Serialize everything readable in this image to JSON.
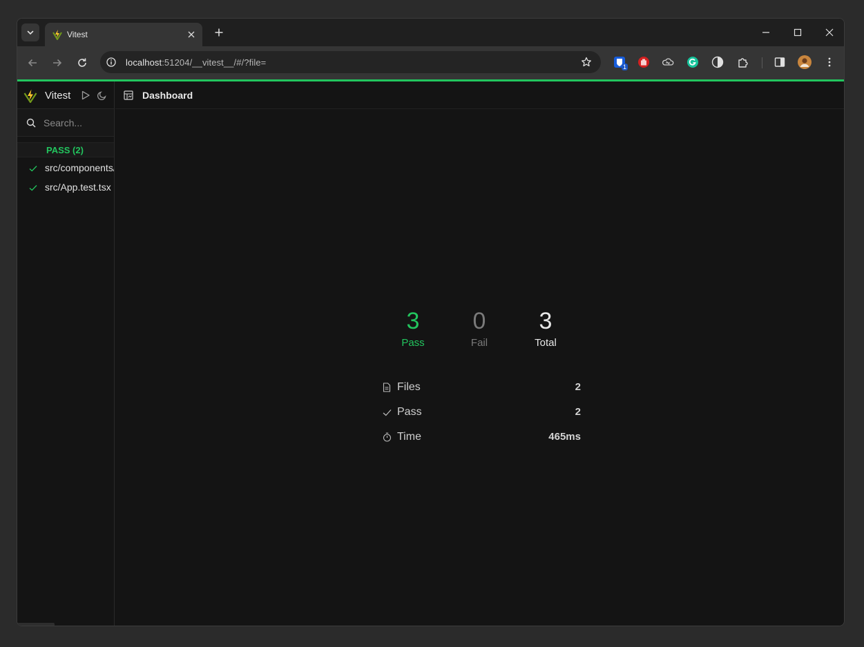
{
  "browser": {
    "tab_title": "Vitest",
    "url_host": "localhost",
    "url_rest": ":51204/__vitest__/#/?file=",
    "extension_badge": "1"
  },
  "app": {
    "brand": "Vitest",
    "search_placeholder": "Search...",
    "group_label": "PASS (2)",
    "files": [
      {
        "name": "src/components/Counter.test.tsx"
      },
      {
        "name": "src/App.test.tsx"
      }
    ]
  },
  "main": {
    "header_title": "Dashboard",
    "stats": [
      {
        "value": "3",
        "label": "Pass"
      },
      {
        "value": "0",
        "label": "Fail"
      },
      {
        "value": "3",
        "label": "Total"
      }
    ],
    "summary": [
      {
        "label": "Files",
        "value": "2",
        "icon": "file-icon"
      },
      {
        "label": "Pass",
        "value": "2",
        "icon": "check-icon"
      },
      {
        "label": "Time",
        "value": "465ms",
        "icon": "timer-icon"
      }
    ]
  },
  "colors": {
    "accent": "#22c55e",
    "fail_gray": "#7a7a7a",
    "total_white": "#e8e8e8"
  }
}
